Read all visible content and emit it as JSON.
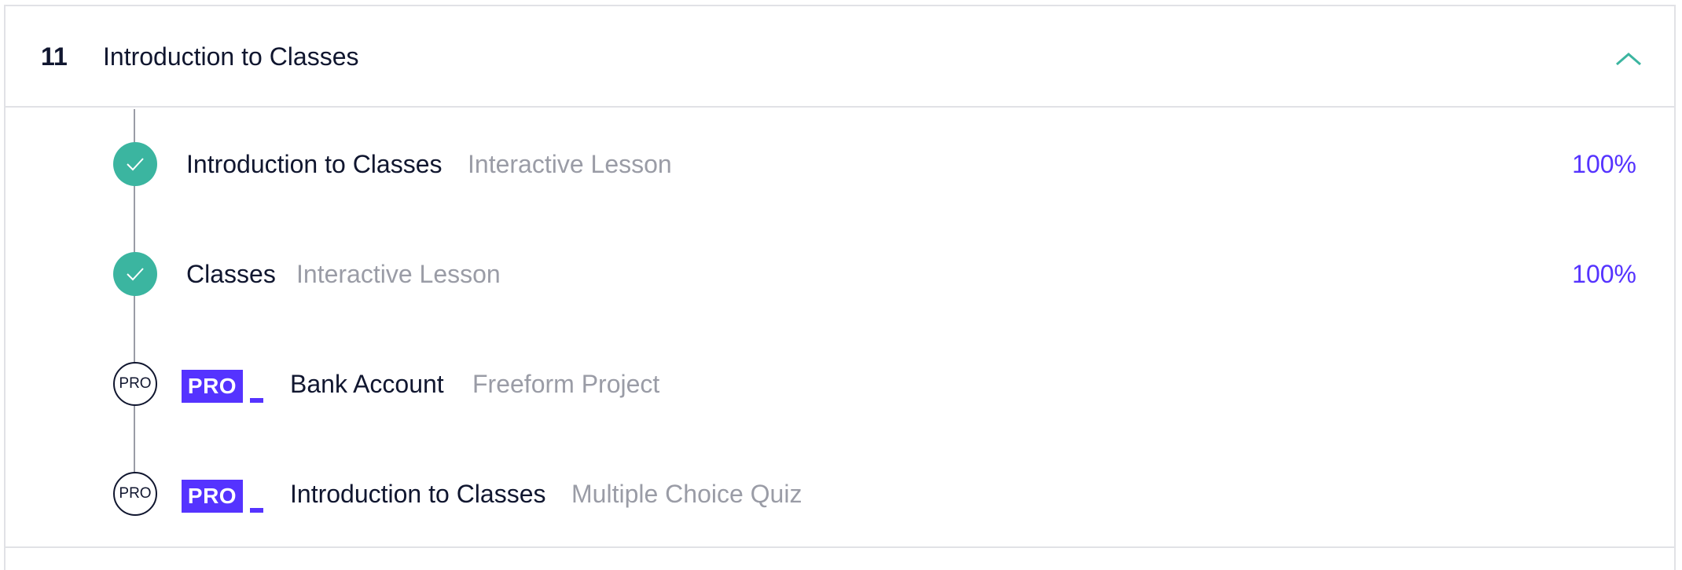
{
  "module": {
    "number": "11",
    "title": "Introduction to Classes",
    "expanded": true,
    "chevron_icon": "chevron-up-icon"
  },
  "colors": {
    "complete": "#3bb5a0",
    "pro": "#5533ff",
    "text": "#10162f",
    "muted": "#9a9ca6",
    "border": "#e1e2e6"
  },
  "items": [
    {
      "title": "Introduction to Classes",
      "type": "Interactive Lesson",
      "status": "complete",
      "percent": "100%"
    },
    {
      "title": "Classes",
      "type": "Interactive Lesson",
      "status": "complete",
      "percent": "100%"
    },
    {
      "title": "Bank Account",
      "type": "Freeform Project",
      "status": "pro",
      "status_label": "PRO",
      "badge": "PRO"
    },
    {
      "title": "Introduction to Classes",
      "type": "Multiple Choice Quiz",
      "status": "pro",
      "status_label": "PRO",
      "badge": "PRO"
    }
  ]
}
